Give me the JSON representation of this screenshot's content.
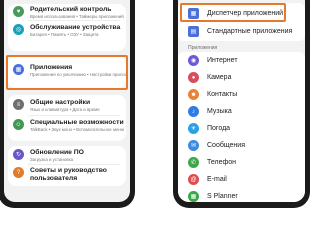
{
  "left_phone": {
    "rows": [
      {
        "title": "Родительский контроль",
        "subtitle": "Время использования • Таймеры приложений",
        "icon": "family-icon",
        "color": "#4a9a5c"
      },
      {
        "title": "Обслуживание устройства",
        "subtitle": "Батарея • Память • ОЗУ • Защита",
        "icon": "device-care-icon",
        "color": "#18a2b8"
      },
      {
        "title": "Приложения",
        "subtitle": "Приложения по умолчанию • Настройки приложений",
        "icon": "apps-icon",
        "color": "#4c6fd8"
      },
      {
        "title": "Общие настройки",
        "subtitle": "Язык и клавиатура • Дата и время",
        "icon": "general-settings-icon",
        "color": "#6e6e6e"
      },
      {
        "title": "Специальные возможности",
        "subtitle": "TalkBack • Звук моно • Вспомогательное меню",
        "icon": "accessibility-icon",
        "color": "#3f9a4f"
      },
      {
        "title": "Обновление ПО",
        "subtitle": "Загрузка и установка",
        "icon": "software-update-icon",
        "color": "#6a56c8"
      },
      {
        "title": "Советы и руководство",
        "subtitle": "пользователя",
        "icon": "tips-icon",
        "color": "#e07b2a"
      }
    ]
  },
  "right_phone": {
    "top_items": [
      {
        "label": "Диспетчер приложений",
        "icon": "app-manager-icon",
        "color": "#4c6fd8"
      },
      {
        "label": "Стандартные приложения",
        "icon": "default-apps-icon",
        "color": "#4c6fd8"
      }
    ],
    "section_label": "Приложения",
    "apps": [
      {
        "label": "Интернет",
        "icon": "internet-icon",
        "color": "#6b5bd6",
        "glyph": "◉"
      },
      {
        "label": "Камера",
        "icon": "camera-icon",
        "color": "#d94c5c",
        "glyph": "●"
      },
      {
        "label": "Контакты",
        "icon": "contacts-icon",
        "color": "#e8833a",
        "glyph": "☻"
      },
      {
        "label": "Музыка",
        "icon": "music-icon",
        "color": "#2f7be8",
        "glyph": "♪"
      },
      {
        "label": "Погода",
        "icon": "weather-icon",
        "color": "#2aa1e3",
        "glyph": "☀"
      },
      {
        "label": "Сообщения",
        "icon": "messages-icon",
        "color": "#3b8ae6",
        "glyph": "✉"
      },
      {
        "label": "Телефон",
        "icon": "phone-icon",
        "color": "#3ca64a",
        "glyph": "✆"
      },
      {
        "label": "E-mail",
        "icon": "email-icon",
        "color": "#e04b4b",
        "glyph": "@"
      },
      {
        "label": "S Planner",
        "icon": "calendar-icon",
        "color": "#3ca64a",
        "glyph": "▦"
      }
    ]
  }
}
